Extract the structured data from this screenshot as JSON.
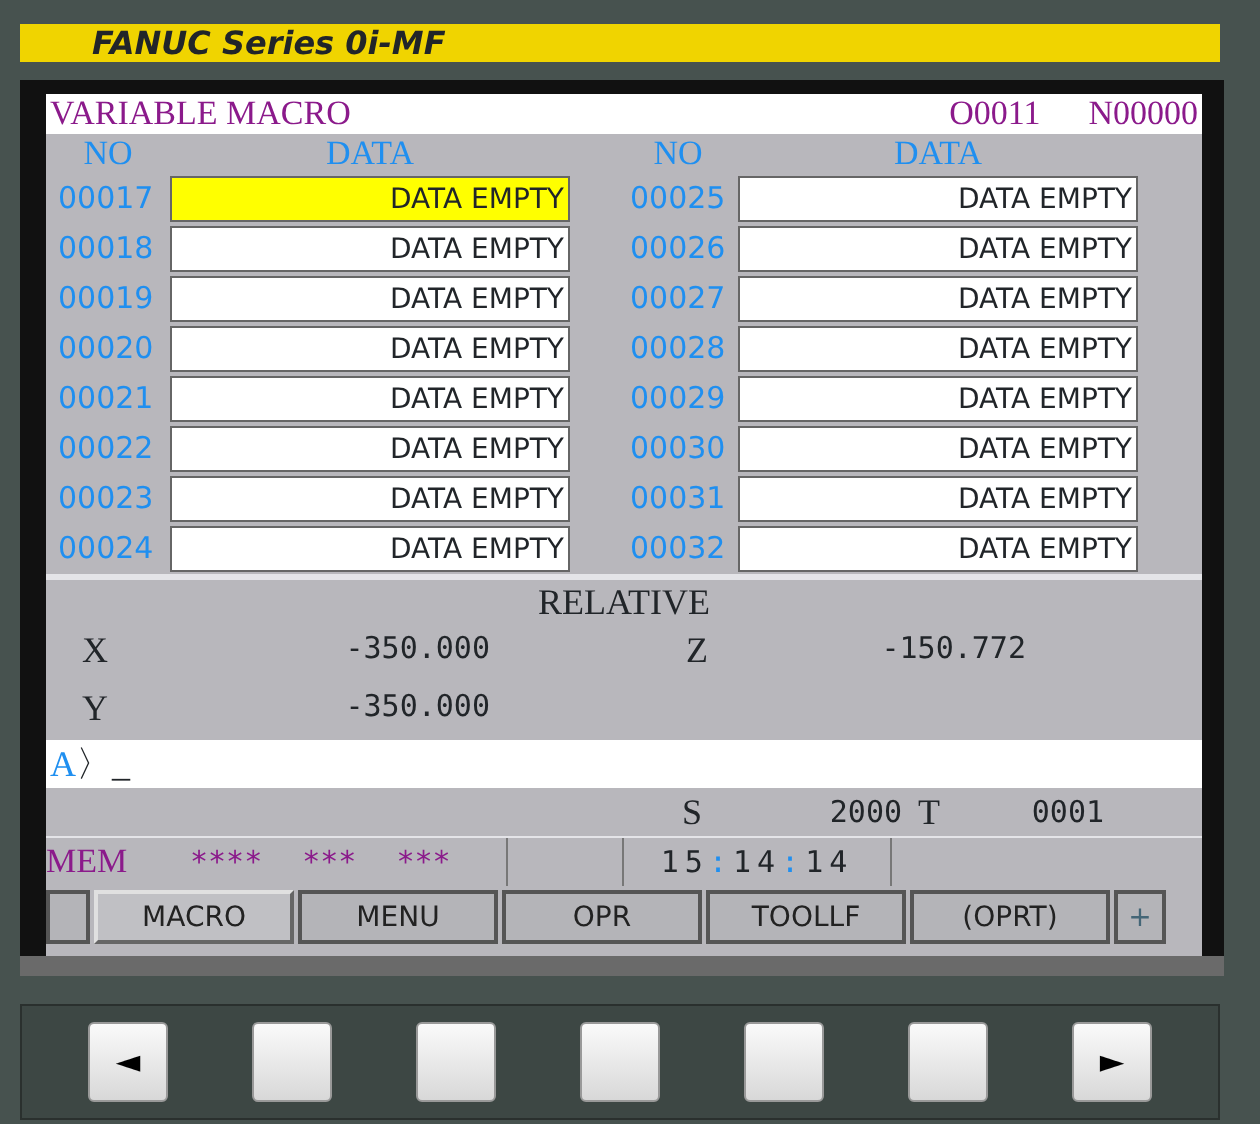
{
  "brand": "FANUC Series 0i-MF",
  "screen": {
    "title": "VARIABLE MACRO",
    "program": "O0011",
    "sequence": "N00000"
  },
  "columns": [
    {
      "no": "NO",
      "data": "DATA"
    },
    {
      "no": "NO",
      "data": "DATA"
    }
  ],
  "variables": [
    [
      {
        "no": "00017",
        "value": "DATA EMPTY",
        "selected": true
      },
      {
        "no": "00018",
        "value": "DATA EMPTY",
        "selected": false
      },
      {
        "no": "00019",
        "value": "DATA EMPTY",
        "selected": false
      },
      {
        "no": "00020",
        "value": "DATA EMPTY",
        "selected": false
      },
      {
        "no": "00021",
        "value": "DATA EMPTY",
        "selected": false
      },
      {
        "no": "00022",
        "value": "DATA EMPTY",
        "selected": false
      },
      {
        "no": "00023",
        "value": "DATA EMPTY",
        "selected": false
      },
      {
        "no": "00024",
        "value": "DATA EMPTY",
        "selected": false
      }
    ],
    [
      {
        "no": "00025",
        "value": "DATA EMPTY",
        "selected": false
      },
      {
        "no": "00026",
        "value": "DATA EMPTY",
        "selected": false
      },
      {
        "no": "00027",
        "value": "DATA EMPTY",
        "selected": false
      },
      {
        "no": "00028",
        "value": "DATA EMPTY",
        "selected": false
      },
      {
        "no": "00029",
        "value": "DATA EMPTY",
        "selected": false
      },
      {
        "no": "00030",
        "value": "DATA EMPTY",
        "selected": false
      },
      {
        "no": "00031",
        "value": "DATA EMPTY",
        "selected": false
      },
      {
        "no": "00032",
        "value": "DATA EMPTY",
        "selected": false
      }
    ]
  ],
  "position": {
    "title": "RELATIVE",
    "axes": [
      {
        "axis": "X",
        "value": "-350.000"
      },
      {
        "axis": "Z",
        "value": "-150.772"
      },
      {
        "axis": "Y",
        "value": "-350.000"
      }
    ]
  },
  "input": {
    "prompt": "A",
    "marker": "〉",
    "cursor": "_"
  },
  "spindle": {
    "s_label": "S",
    "s_value": "2000",
    "t_label": "T",
    "t_value": "0001"
  },
  "status": {
    "mode": "MEM",
    "fields": [
      "****",
      "***",
      "***"
    ],
    "time": {
      "hours": "15",
      "minutes": "14",
      "seconds": "14",
      "separator": ":"
    }
  },
  "softkeys": [
    {
      "kind": "blank",
      "selected": false
    },
    {
      "kind": "label",
      "label": "MACRO",
      "selected": true
    },
    {
      "kind": "label",
      "label": "MENU",
      "selected": false
    },
    {
      "kind": "label",
      "label": "OPR",
      "selected": false
    },
    {
      "kind": "label",
      "label": "TOOLLF",
      "selected": false
    },
    {
      "kind": "label",
      "label": "(OPRT)",
      "selected": false
    },
    {
      "kind": "more",
      "label": "+",
      "selected": false
    }
  ],
  "hardkeys": [
    {
      "kind": "arrow",
      "label": "◄"
    },
    {
      "kind": "blank"
    },
    {
      "kind": "blank"
    },
    {
      "kind": "blank"
    },
    {
      "kind": "blank"
    },
    {
      "kind": "blank"
    },
    {
      "kind": "arrow",
      "label": "►"
    }
  ]
}
